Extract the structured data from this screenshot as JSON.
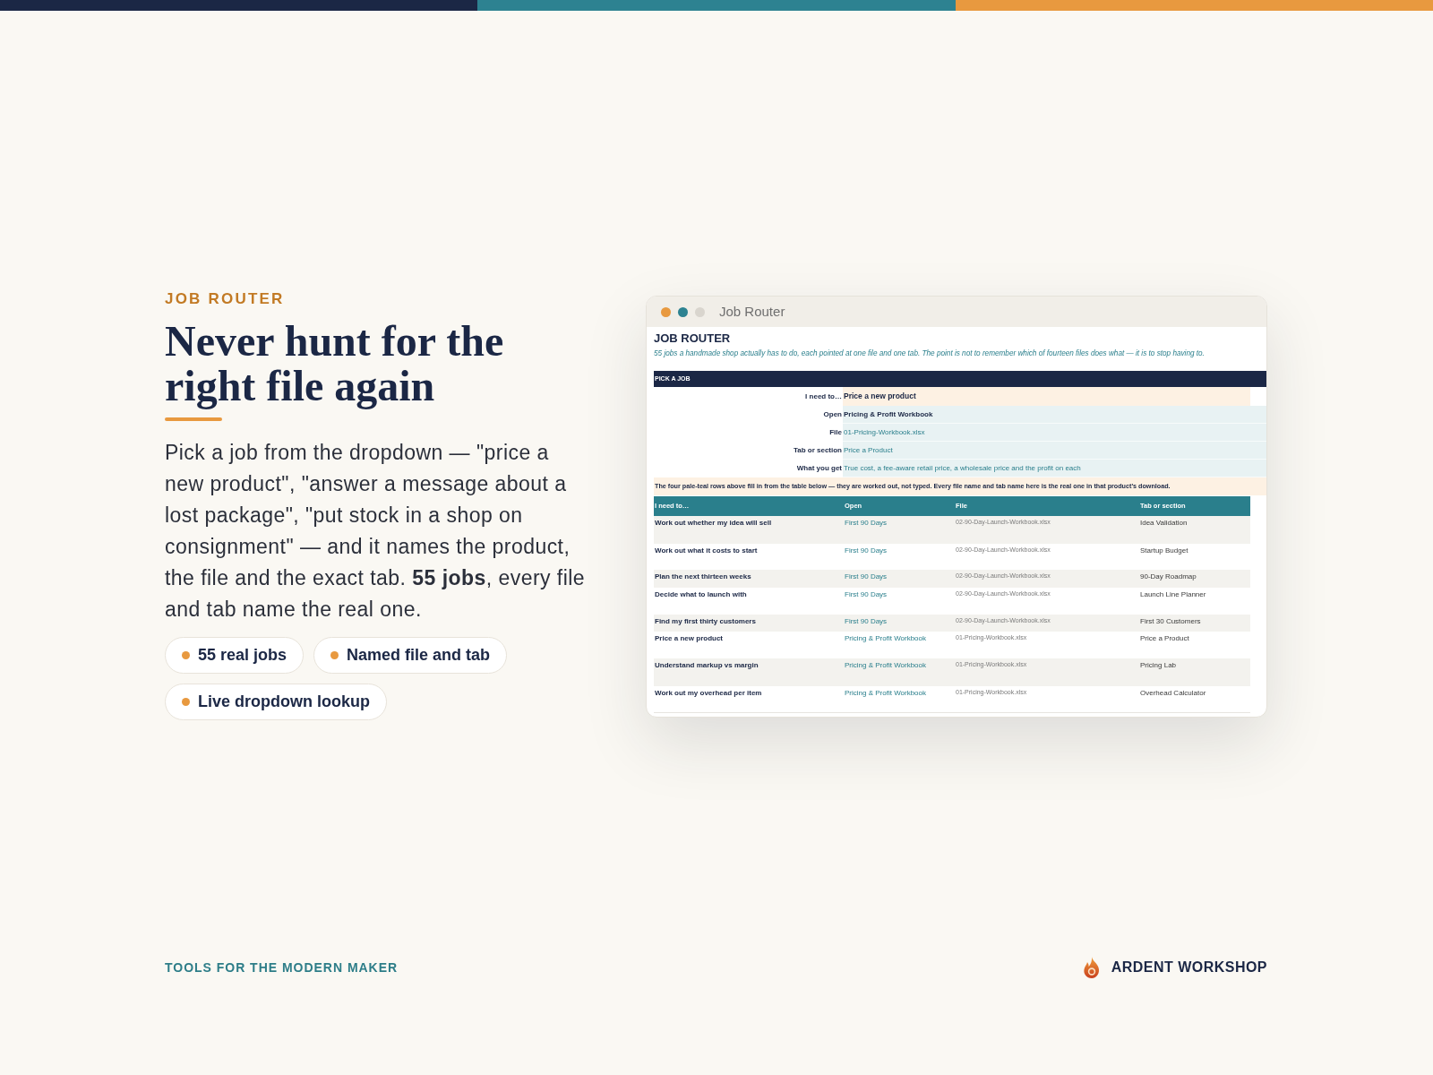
{
  "hero": {
    "eyebrow": "JOB ROUTER",
    "title": "Never hunt for the right file again",
    "description": "Pick a job from the dropdown — \"price a new product\", \"answer a message about a lost package\", \"put stock in a shop on consignment\" — and it names the product, the file and the exact tab. **55 jobs**, every file and tab name the real one.",
    "features": [
      "55 real jobs",
      "Named file and tab",
      "Live dropdown lookup"
    ]
  },
  "window": {
    "title": "Job Router",
    "sheet": {
      "heading": "JOB ROUTER",
      "subtitle": "55 jobs a handmade shop actually has to do, each pointed at one file and one tab. The point is not to remember which of fourteen files does what — it is to stop having to.",
      "section": "PICK A JOB",
      "picker": [
        {
          "kind": "dropdown",
          "label": "I need to…",
          "value": "Price a new product"
        },
        {
          "kind": "product",
          "label": "Open",
          "value": "Pricing & Profit Workbook"
        },
        {
          "kind": "detail",
          "label": "File",
          "value": "01-Pricing-Workbook.xlsx"
        },
        {
          "kind": "detail",
          "label": "Tab or section",
          "value": "Price a Product"
        },
        {
          "kind": "detail",
          "label": "What you get",
          "value": "True cost, a fee-aware retail price, a wholesale price and the profit on each"
        }
      ],
      "note": "The four pale-teal rows above fill in from the table below — they are worked out, not typed. Every file name and tab name here is the real one in that product's download.",
      "table": {
        "columns": [
          "I need to…",
          "Open",
          "File",
          "Tab or section"
        ],
        "rows": [
          [
            "Work out whether my idea will sell",
            "First 90 Days",
            "02-90-Day-Launch-Workbook.xlsx",
            "Idea Validation"
          ],
          [
            "Work out what it costs to start",
            "First 90 Days",
            "02-90-Day-Launch-Workbook.xlsx",
            "Startup Budget"
          ],
          [
            "Plan the next thirteen weeks",
            "First 90 Days",
            "02-90-Day-Launch-Workbook.xlsx",
            "90-Day Roadmap"
          ],
          [
            "Decide what to launch with",
            "First 90 Days",
            "02-90-Day-Launch-Workbook.xlsx",
            "Launch Line Planner"
          ],
          [
            "Find my first thirty customers",
            "First 90 Days",
            "02-90-Day-Launch-Workbook.xlsx",
            "First 30 Customers"
          ],
          [
            "Price a new product",
            "Pricing & Profit Workbook",
            "01-Pricing-Workbook.xlsx",
            "Price a Product"
          ],
          [
            "Understand markup vs margin",
            "Pricing & Profit Workbook",
            "01-Pricing-Workbook.xlsx",
            "Pricing Lab"
          ],
          [
            "Work out my overhead per item",
            "Pricing & Profit Workbook",
            "01-Pricing-Workbook.xlsx",
            "Overhead Calculator"
          ]
        ]
      }
    }
  },
  "footer": {
    "tagline": "TOOLS FOR THE MODERN MAKER",
    "brand": "ARDENT WORKSHOP"
  }
}
